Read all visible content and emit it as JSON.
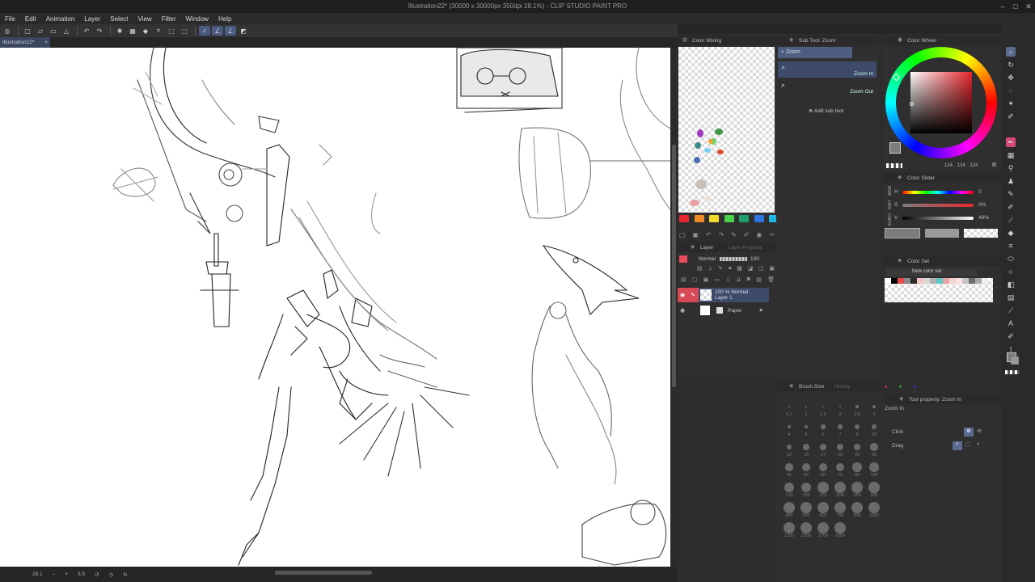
{
  "window": {
    "title": "Illustration22* (30000 x 30000px 350dpi 28.1%) - CLIP STUDIO PAINT PRO"
  },
  "menu": [
    "File",
    "Edit",
    "Animation",
    "Layer",
    "Select",
    "View",
    "Filter",
    "Window",
    "Help"
  ],
  "document_tab": {
    "label": "Illustration22*",
    "close": "×"
  },
  "status": {
    "zoom": "28.1",
    "angle": "3.5"
  },
  "panels": {
    "color_mixing": {
      "title": "Color Mixing"
    },
    "sub_tool": {
      "title": "Sub Tool: Zoom",
      "tab": "Zoom",
      "items": [
        "Zoom In",
        "Zoom Out"
      ],
      "add_label": "Add sub tool"
    },
    "color_wheel": {
      "title": "Color Wheel",
      "values": [
        "124",
        "124",
        "124"
      ]
    },
    "color_slider": {
      "title": "Color Slider",
      "h_label": "H",
      "h_value": "0",
      "s_label": "S",
      "s_value": "0%",
      "v_label": "V",
      "v_value": "49%",
      "mode_labels": [
        "RGB",
        "HSV",
        "CMYK"
      ]
    },
    "color_set": {
      "title": "Color Set",
      "set_name": "New color set"
    },
    "layer": {
      "title": "Layer",
      "tab2": "Layer Property",
      "blend": "Normal",
      "opacity": "100",
      "layers": [
        {
          "line1": "100 % Normal",
          "line2": "Layer 1",
          "selected": true
        },
        {
          "line1": "Paper",
          "line2": "",
          "selected": false
        }
      ]
    },
    "brush_size": {
      "title": "Brush Size",
      "tab2": "History",
      "sizes": [
        "0.7",
        "1",
        "1.5",
        "2",
        "2.5",
        "3",
        "4",
        "5",
        "6",
        "7",
        "8",
        "10",
        "12",
        "15",
        "17",
        "20",
        "25",
        "30",
        "40",
        "50",
        "60",
        "70",
        "80",
        "100",
        "120",
        "150",
        "170",
        "200",
        "250",
        "300",
        "400",
        "500",
        "600",
        "700",
        "800",
        "1000",
        "1200",
        "1500",
        "1700",
        "2000"
      ]
    },
    "tool_property": {
      "title": "Tool property: Zoom In",
      "name": "Zoom In",
      "click_label": "Click",
      "drag_label": "Drag"
    }
  },
  "colors": {
    "accent": "#5a6a90",
    "palette": [
      "#e8262d",
      "#f08a24",
      "#f2d92b",
      "#4bd14b",
      "#1f9e6e",
      "#2d76e0",
      "#1fb6e8"
    ],
    "main_color": "#7c7c7c",
    "color_set_swatches": [
      "#ffffff",
      "#000000",
      "#e84b4b",
      "#8a8a8a",
      "#2b2b2b",
      "#f5c6c6",
      "#d9d9d9",
      "#b0b0b0",
      "#60c9c9",
      "#e8a3a3",
      "#f3d4d4",
      "#ffe1e1",
      "#c5c5c5",
      "#6c6c6c",
      "#a8a8a8",
      "#eeeeee"
    ]
  }
}
